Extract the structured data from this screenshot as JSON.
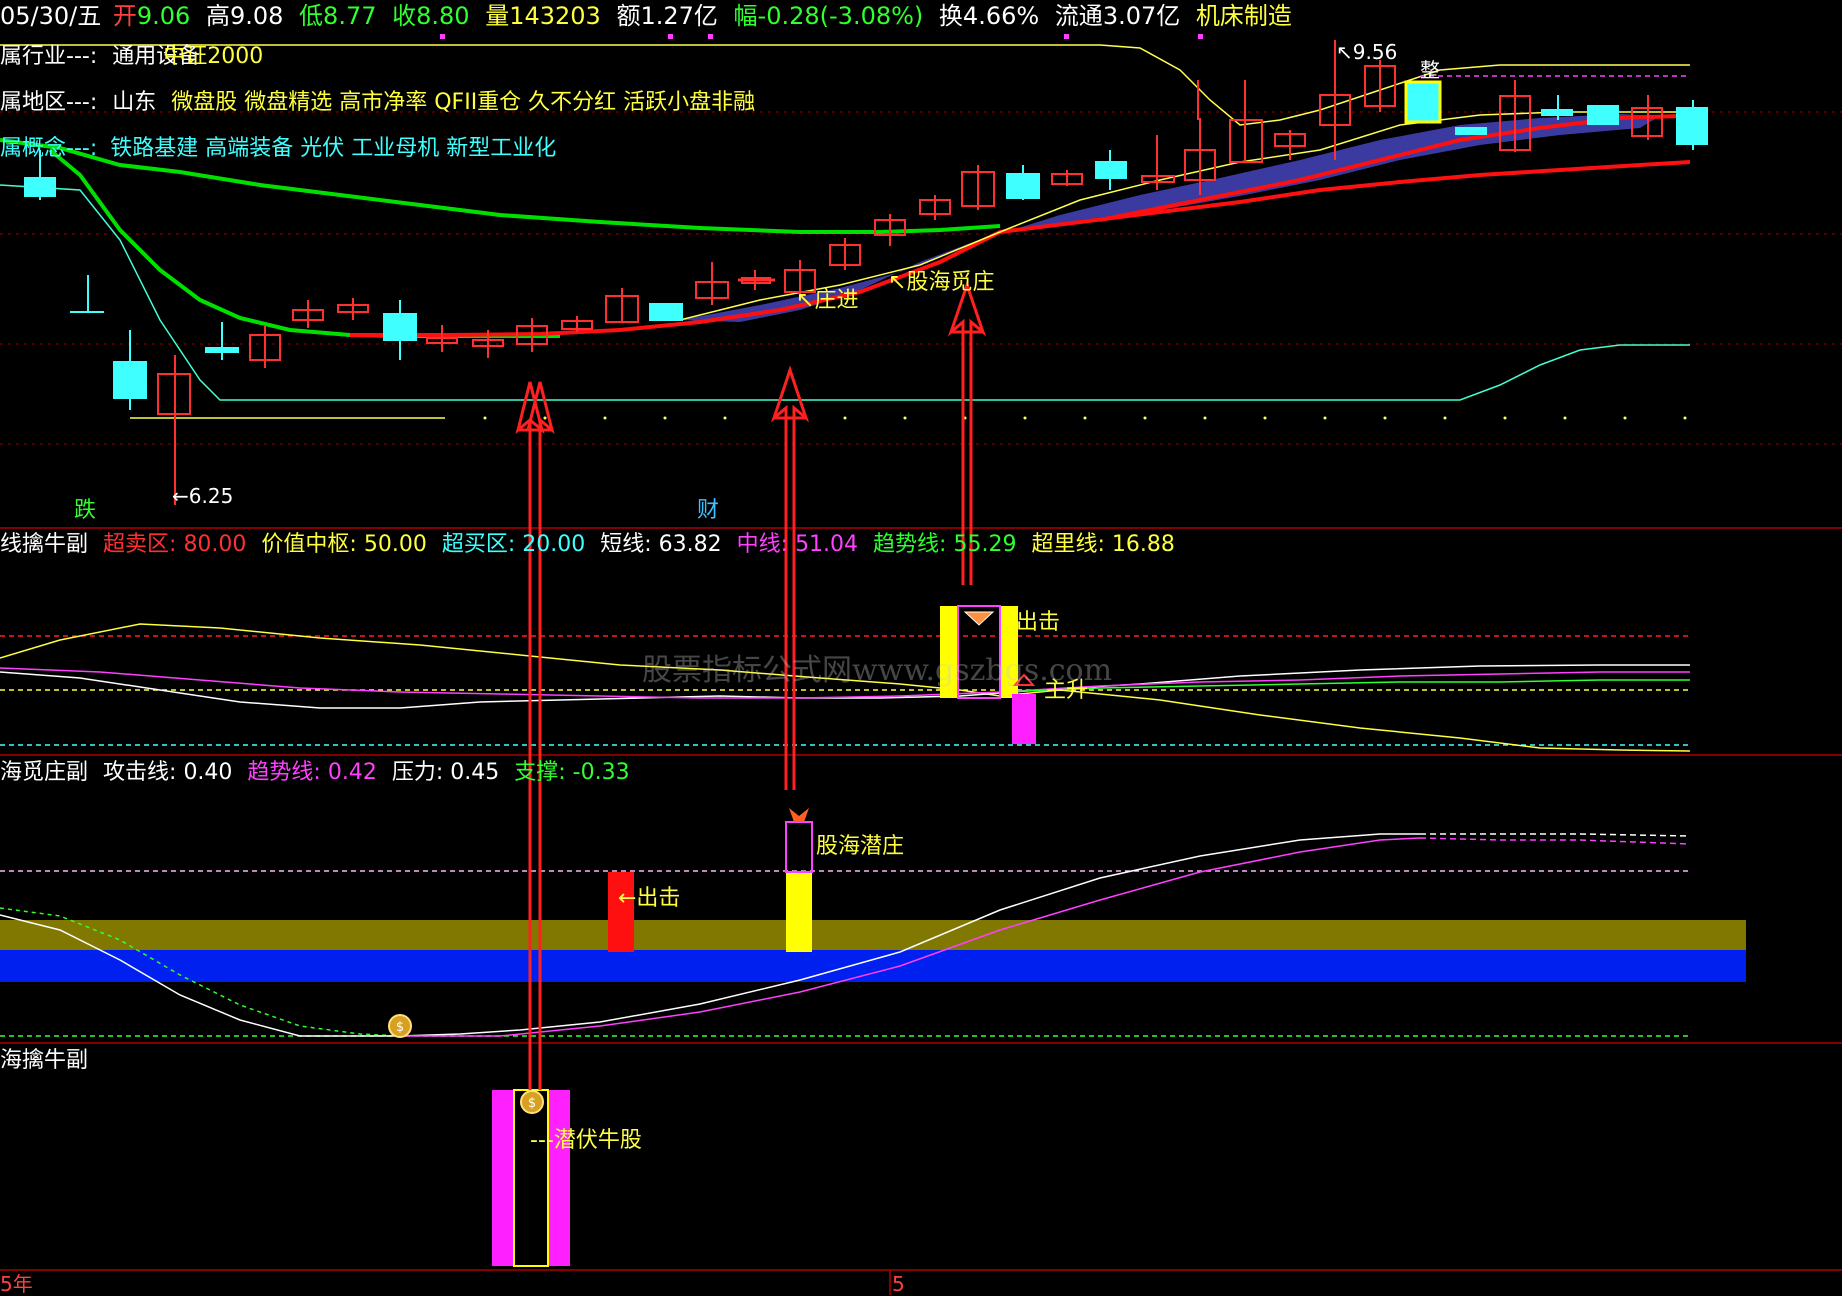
{
  "header": {
    "date": "05/30/五",
    "open_label": "开",
    "open": "9.06",
    "high_label": "高",
    "high": "9.08",
    "low_label": "低",
    "low": "8.77",
    "close_label": "收",
    "close": "8.80",
    "volume_label": "量",
    "volume": "143203",
    "amount_label": "额",
    "amount": "1.27亿",
    "change_label": "幅",
    "change": "-0.28(-3.08%)",
    "turnover_label": "换",
    "turnover": "4.66%",
    "float_label": "流通",
    "float": "3.07亿",
    "sector": "机床制造"
  },
  "info": {
    "industry_label": "属行业---:",
    "industry_value": "通用设备",
    "industry_overlay": "中证2000",
    "region_label": "属地区---:",
    "region_value": "山东",
    "region_tags": "微盘股 微盘精选 高市净率 QFII重仓 久不分红 活跃小盘非融",
    "concept_label": "属概念---:",
    "concept_tags": "铁路基建 高端装备 光伏 工业母机 新型工业化"
  },
  "main_chart": {
    "price_high": "9.56",
    "price_low": "6.25",
    "tag_die": "跌",
    "tag_cai": "财",
    "annot_zhuangjin": "庄进",
    "annot_guhai": "股海觅庄",
    "annot_top": "整"
  },
  "panel1": {
    "title": "线擒牛副",
    "oversold_label": "超卖区:",
    "oversold": "80.00",
    "value_label": "价值中枢:",
    "value": "50.00",
    "overbought_label": "超买区:",
    "overbought": "20.00",
    "short_label": "短线:",
    "short": "63.82",
    "mid_label": "中线:",
    "mid": "51.04",
    "trend_label": "趋势线:",
    "trend": "55.29",
    "super_label": "超里线:",
    "super": "16.88",
    "annot_chuji": "出击",
    "annot_zhusheng": "主升"
  },
  "panel2": {
    "title": "海觅庄副",
    "attack_label": "攻击线:",
    "attack": "0.40",
    "trend_label": "趋势线:",
    "trend": "0.42",
    "pressure_label": "压力:",
    "pressure": "0.45",
    "support_label": "支撑:",
    "support": "-0.33",
    "annot_chuji": "←出击",
    "annot_qianzhuang": "股海潜庄"
  },
  "panel3": {
    "title": "海擒牛副",
    "annot_qianfu": "---潜伏牛股"
  },
  "watermark": "股票指标公式网www.gszbgs.com",
  "time_axis": {
    "label_left": "5年",
    "label_mid": "5"
  }
}
